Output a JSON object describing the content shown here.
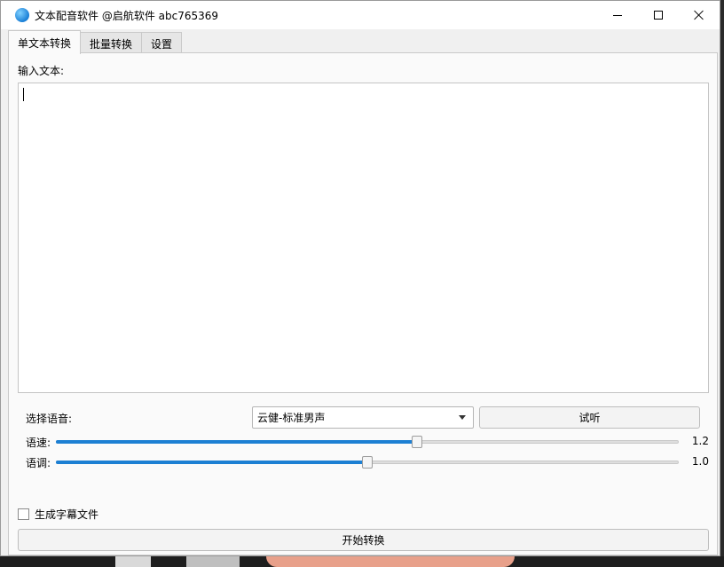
{
  "window": {
    "title": "文本配音软件 @启航软件 abc765369"
  },
  "tabs": [
    {
      "label": "单文本转换",
      "active": true
    },
    {
      "label": "批量转换",
      "active": false
    },
    {
      "label": "设置",
      "active": false
    }
  ],
  "single": {
    "input_label": "输入文本:",
    "input_value": "",
    "voice_label": "选择语音:",
    "voice_selected": "云健-标准男声",
    "listen_button": "试听",
    "speed": {
      "label": "语速:",
      "value_text": "1.2",
      "level_percent": 58
    },
    "pitch": {
      "label": "语调:",
      "value_text": "1.0",
      "level_percent": 50
    },
    "subtitle_checkbox": {
      "label": "生成字幕文件",
      "checked": false
    },
    "start_button": "开始转换"
  },
  "colors": {
    "accent": "#1c7fd3",
    "window_bg": "#f0f0f0"
  },
  "icons": [
    "app-globe-icon",
    "minimize-icon",
    "maximize-icon",
    "close-icon",
    "chevron-down-icon"
  ]
}
